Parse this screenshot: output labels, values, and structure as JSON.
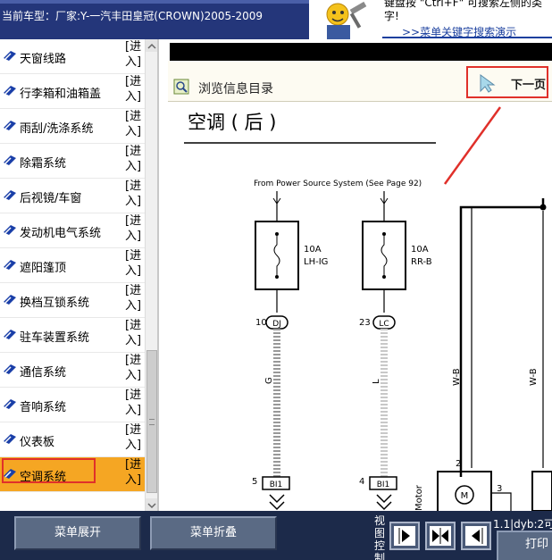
{
  "header": {
    "car_model": "当前车型：厂家:Y-一汽丰田皇冠(CROWN)2005-2009",
    "tip_text": "键盘按 \"Ctrl+F\" 可搜索左侧的类字!",
    "tip_link": ">>菜单关键字搜索演示"
  },
  "sidebar": {
    "enter_label": "[进入]",
    "items": [
      {
        "label": "天窗线路",
        "active": false
      },
      {
        "label": "行李箱和油箱盖",
        "active": false
      },
      {
        "label": "雨刮/洗涤系统",
        "active": false
      },
      {
        "label": "除霜系统",
        "active": false
      },
      {
        "label": "后视镜/车窗",
        "active": false
      },
      {
        "label": "发动机电气系统",
        "active": false
      },
      {
        "label": "遮阳篷顶",
        "active": false
      },
      {
        "label": "换档互锁系统",
        "active": false
      },
      {
        "label": "驻车装置系统",
        "active": false
      },
      {
        "label": "通信系统",
        "active": false
      },
      {
        "label": "音响系统",
        "active": false
      },
      {
        "label": "仪表板",
        "active": false
      },
      {
        "label": "空调系统",
        "active": true
      }
    ]
  },
  "content": {
    "toc_label": "浏览信息目录",
    "next_page_label": "下一页"
  },
  "diagram": {
    "title": "空调 ( 后 )",
    "source_note": "From Power Source System (See Page 92)",
    "fuses": [
      {
        "rating": "10A",
        "name": "LH-IG"
      },
      {
        "rating": "10A",
        "name": "RR-B"
      }
    ],
    "connectors": [
      {
        "pin": "10",
        "code": "DJ"
      },
      {
        "pin": "23",
        "code": "LC"
      }
    ],
    "wires": [
      "G",
      "L",
      "W-B",
      "W-B"
    ],
    "bottom_connectors": [
      {
        "pin": "5",
        "code": "BI1"
      },
      {
        "pin": "4",
        "code": "BI1"
      }
    ],
    "motor_label": "Motor",
    "motor_symbol": "M",
    "motor_pins": [
      "2",
      "3"
    ]
  },
  "bottombar": {
    "expand_label": "菜单展开",
    "collapse_label": "菜单折叠",
    "view_ctrl_label": "视图控制",
    "status_text": "1.1|dyb:2可",
    "print_label": "打印"
  },
  "colors": {
    "header_bg": "#24367a",
    "active_item": "#f5a623",
    "highlight_red": "#e0302a",
    "bottombar_bg": "#1c2a4a",
    "link_blue": "#1a3f9e"
  }
}
